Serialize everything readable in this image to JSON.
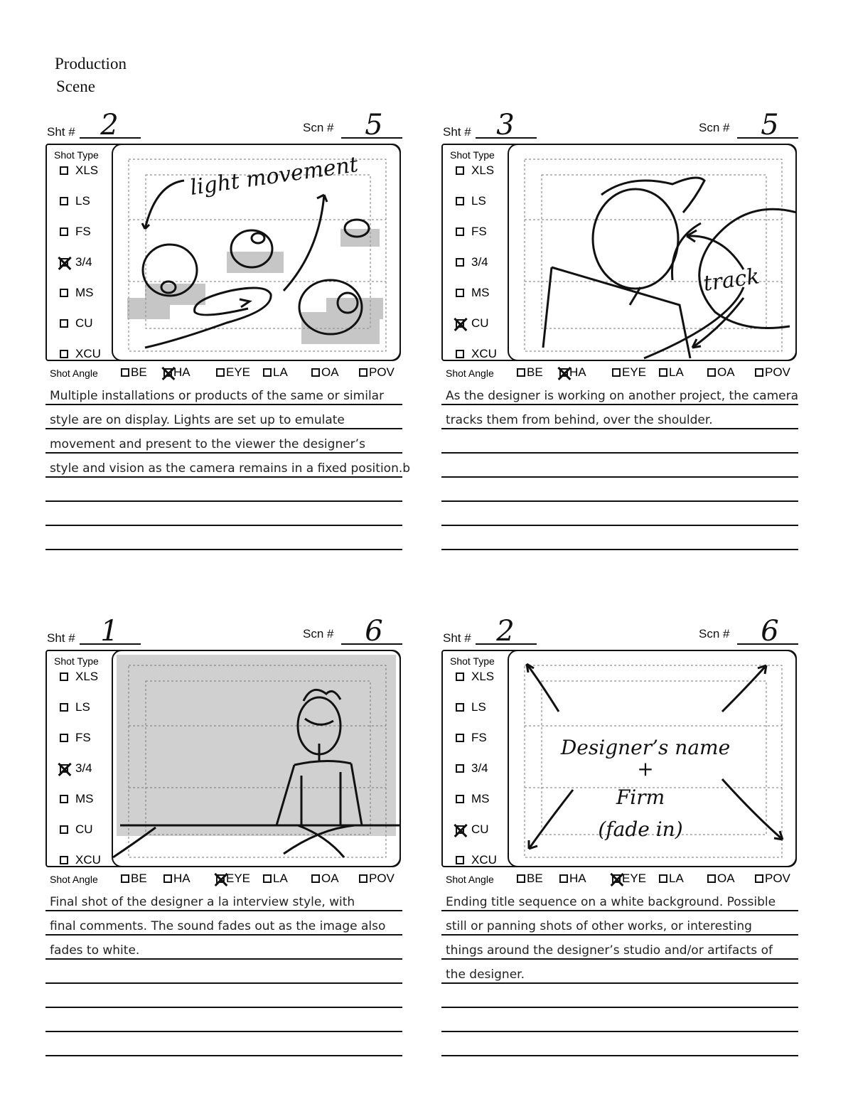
{
  "header": {
    "line1": "Production",
    "line2": "Scene"
  },
  "labels": {
    "sht": "Sht #",
    "scn": "Scn #",
    "shot_type": "Shot Type",
    "shot_angle": "Shot Angle"
  },
  "shot_types": [
    "XLS",
    "LS",
    "FS",
    "3/4",
    "MS",
    "CU",
    "XCU"
  ],
  "shot_angles": [
    "BE",
    "HA",
    "EYE",
    "LA",
    "OA",
    "POV"
  ],
  "panels": [
    {
      "sht": "2",
      "scn": "5",
      "shot_type_checked": "3/4",
      "shot_angle_checked": "HA",
      "annotations": [
        "light movement"
      ],
      "notes": [
        "Multiple installations or products of the same or similar",
        "style are on display. Lights are set up to emulate",
        "movement and present to the viewer the designer’s",
        "style and vision as the camera remains in a fixed position.b",
        "",
        "",
        ""
      ]
    },
    {
      "sht": "3",
      "scn": "5",
      "shot_type_checked": "CU",
      "shot_angle_checked": "HA",
      "annotations": [
        "track"
      ],
      "notes": [
        "As the designer is working on another project, the camera",
        "tracks them from behind, over the shoulder.",
        "",
        "",
        "",
        "",
        ""
      ]
    },
    {
      "sht": "1",
      "scn": "6",
      "shot_type_checked": "3/4",
      "shot_angle_checked": "EYE",
      "annotations": [],
      "notes": [
        "Final shot of the designer a la interview style, with",
        "final comments. The sound fades out as the image also",
        "fades to white.",
        "",
        "",
        "",
        ""
      ]
    },
    {
      "sht": "2",
      "scn": "6",
      "shot_type_checked": "CU",
      "shot_angle_checked": "EYE",
      "annotations": [
        "Designer’s name",
        "+",
        "Firm",
        "(fade in)"
      ],
      "notes": [
        "Ending title sequence on a white background. Possible",
        "still or panning shots of other works, or interesting",
        "things around the designer’s studio and/or artifacts of",
        "the designer.",
        "",
        "",
        ""
      ]
    }
  ]
}
